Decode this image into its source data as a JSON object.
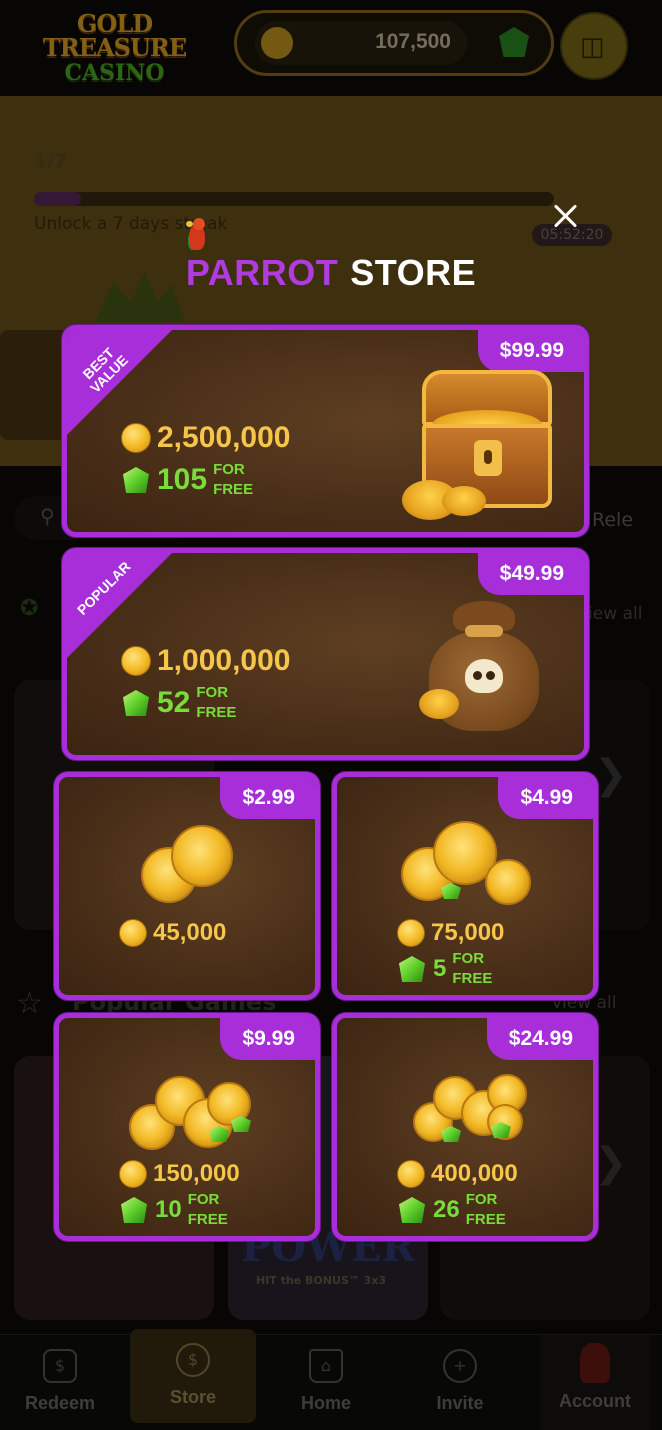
{
  "header": {
    "logo_line1": "GOLD TREASURE",
    "logo_line2": "CASINO",
    "balance": "107,500"
  },
  "banner": {
    "streak_count": "1/7",
    "streak_label": "Unlock a 7 days streak",
    "streak_progress": 0.09,
    "timer": "05:52:20"
  },
  "background": {
    "section_rel": "Rele",
    "view_all_1": "view all",
    "popular_title": "Popular Games",
    "view_all_2": "view all",
    "game_title": "POWER",
    "game_subtitle": "HIT the BONUS™ 3x3"
  },
  "store": {
    "title_word1": "PARROT",
    "title_word2": "STORE",
    "for_free_line1": "FOR",
    "for_free_line2": "FREE",
    "packages": [
      {
        "price": "$99.99",
        "ribbon": "BEST VALUE",
        "coins": "2,500,000",
        "gems": "105"
      },
      {
        "price": "$49.99",
        "ribbon": "POPULAR",
        "coins": "1,000,000",
        "gems": "52"
      },
      {
        "price": "$2.99",
        "coins": "45,000"
      },
      {
        "price": "$4.99",
        "coins": "75,000",
        "gems": "5"
      },
      {
        "price": "$9.99",
        "coins": "150,000",
        "gems": "10"
      },
      {
        "price": "$24.99",
        "coins": "400,000",
        "gems": "26"
      }
    ]
  },
  "nav": {
    "redeem": "Redeem",
    "store": "Store",
    "home": "Home",
    "invite": "Invite",
    "account": "Account"
  },
  "colors": {
    "accent_purple": "#a72ed8",
    "coin_gold": "#f6c64a",
    "gem_green": "#7adc3a",
    "card_brown": "#4a2f18"
  }
}
